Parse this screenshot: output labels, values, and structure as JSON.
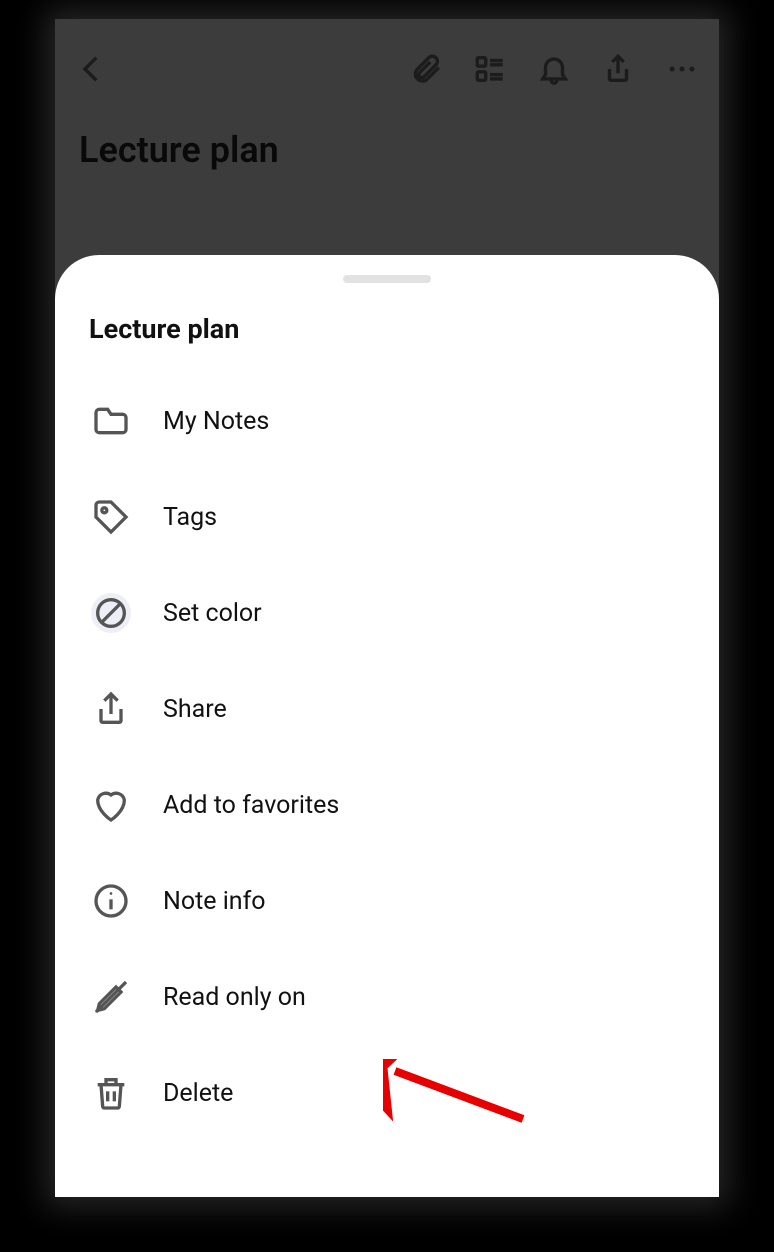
{
  "header": {
    "title": "Lecture plan"
  },
  "sheet": {
    "title": "Lecture plan",
    "items": [
      {
        "label": "My Notes",
        "icon": "folder-icon"
      },
      {
        "label": "Tags",
        "icon": "tag-icon"
      },
      {
        "label": "Set color",
        "icon": "no-color-icon"
      },
      {
        "label": "Share",
        "icon": "share-icon"
      },
      {
        "label": "Add to favorites",
        "icon": "heart-icon"
      },
      {
        "label": "Note info",
        "icon": "info-icon"
      },
      {
        "label": "Read only on",
        "icon": "read-only-icon"
      },
      {
        "label": "Delete",
        "icon": "trash-icon"
      }
    ]
  },
  "annotation": {
    "arrow_target": "read-only-on"
  }
}
